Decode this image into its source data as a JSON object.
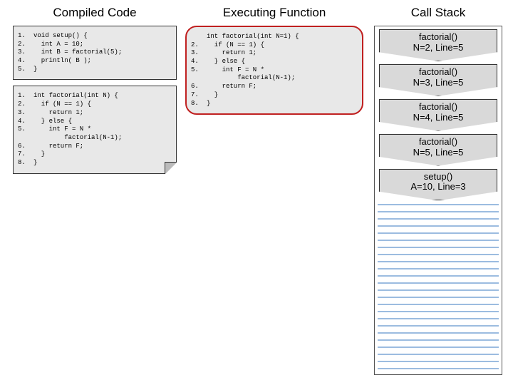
{
  "titles": {
    "compiled": "Compiled Code",
    "executing": "Executing Function",
    "stack": "Call Stack"
  },
  "compiled": {
    "setup": [
      {
        "n": "1.",
        "c": "void setup() {"
      },
      {
        "n": "2.",
        "c": "  int A = 10;"
      },
      {
        "n": "3.",
        "c": "  int B = factorial(5);"
      },
      {
        "n": "4.",
        "c": "  println( B );"
      },
      {
        "n": "5.",
        "c": "}"
      }
    ],
    "factorial": [
      {
        "n": "1.",
        "c": "int factorial(int N) {"
      },
      {
        "n": "2.",
        "c": "  if (N == 1) {"
      },
      {
        "n": "3.",
        "c": "    return 1;"
      },
      {
        "n": "4.",
        "c": "  } else {"
      },
      {
        "n": "5.",
        "c": "    int F = N *"
      },
      {
        "n": "",
        "c": "        factorial(N-1);"
      },
      {
        "n": "6.",
        "c": "    return F;"
      },
      {
        "n": "7.",
        "c": "  }"
      },
      {
        "n": "8.",
        "c": "}"
      }
    ]
  },
  "executing": [
    {
      "n": "",
      "c": "int factorial(int N=1) {"
    },
    {
      "n": "2.",
      "c": "  if (N == 1) {"
    },
    {
      "n": "3.",
      "c": "    return 1;"
    },
    {
      "n": "4.",
      "c": "  } else {"
    },
    {
      "n": "5.",
      "c": "    int F = N *"
    },
    {
      "n": "",
      "c": "        factorial(N-1);"
    },
    {
      "n": "6.",
      "c": "    return F;"
    },
    {
      "n": "7.",
      "c": "  }"
    },
    {
      "n": "8.",
      "c": "}"
    }
  ],
  "stack": [
    {
      "l1": "factorial()",
      "l2": "N=2, Line=5"
    },
    {
      "l1": "factorial()",
      "l2": "N=3, Line=5"
    },
    {
      "l1": "factorial()",
      "l2": "N=4, Line=5"
    },
    {
      "l1": "factorial()",
      "l2": "N=5, Line=5"
    },
    {
      "l1": "setup()",
      "l2": "A=10, Line=3"
    }
  ]
}
